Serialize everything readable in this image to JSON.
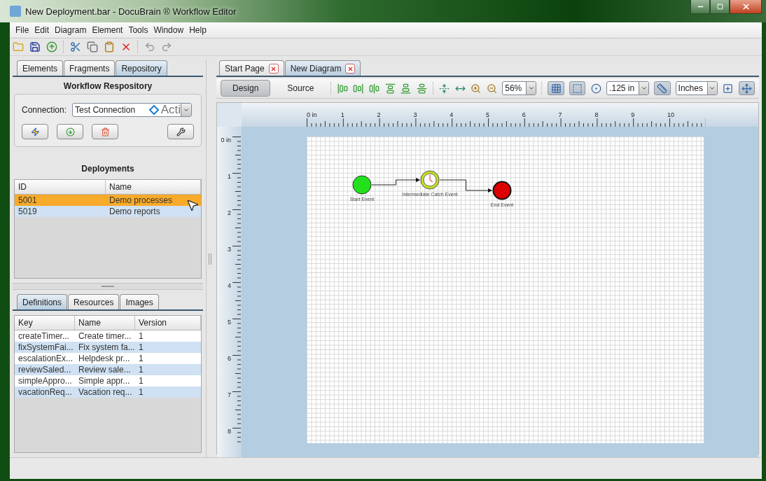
{
  "window": {
    "title": "New Deployment.bar - DocuBrain ® Workflow Editor"
  },
  "menu": [
    "File",
    "Edit",
    "Diagram",
    "Element",
    "Tools",
    "Window",
    "Help"
  ],
  "toolbar": [
    {
      "kind": "open",
      "disabled": false
    },
    {
      "kind": "save",
      "disabled": false
    },
    {
      "kind": "deploy",
      "disabled": false
    },
    {
      "kind": "separator"
    },
    {
      "kind": "cut",
      "disabled": false
    },
    {
      "kind": "copy",
      "disabled": false
    },
    {
      "kind": "paste",
      "disabled": false
    },
    {
      "kind": "delete",
      "disabled": false
    },
    {
      "kind": "separator"
    },
    {
      "kind": "undo",
      "disabled": true
    },
    {
      "kind": "redo",
      "disabled": true
    }
  ],
  "side_tabs": [
    {
      "label": "Elements",
      "selected": false
    },
    {
      "label": "Fragments",
      "selected": false
    },
    {
      "label": "Repository",
      "selected": true
    }
  ],
  "repository": {
    "title": "Workflow Respository",
    "connection_label": "Connection:",
    "connection_value": "Test Connection",
    "connection_brand": "Acti"
  },
  "deployments": {
    "title": "Deployments",
    "columns": [
      "ID",
      "Name"
    ],
    "rows": [
      {
        "cells": [
          "5001",
          "Demo processes"
        ],
        "selected": true
      },
      {
        "cells": [
          "5019",
          "Demo reports"
        ],
        "selected": false
      }
    ]
  },
  "lower_tabs": [
    {
      "label": "Definitions",
      "selected": true
    },
    {
      "label": "Resources",
      "selected": false
    },
    {
      "label": "Images",
      "selected": false
    }
  ],
  "definitions": {
    "columns": [
      "Key",
      "Name",
      "Version"
    ],
    "rows": [
      [
        "createTimer...",
        "Create timer...",
        "1"
      ],
      [
        "fixSystemFai...",
        "Fix system fa...",
        "1"
      ],
      [
        "escalationEx...",
        "Helpdesk pr...",
        "1"
      ],
      [
        "reviewSaled...",
        "Review sale...",
        "1"
      ],
      [
        "simpleAppro...",
        "Simple appr...",
        "1"
      ],
      [
        "vacationReq...",
        "Vacation req...",
        "1"
      ]
    ]
  },
  "doc_tabs": [
    {
      "label": "Start Page",
      "selected": false
    },
    {
      "label": "New Diagram",
      "selected": true
    }
  ],
  "modes": [
    {
      "label": "Design",
      "selected": true
    },
    {
      "label": "Source",
      "selected": false
    }
  ],
  "diagram_toolbar": [
    {
      "kind": "align-left",
      "pressed": false
    },
    {
      "kind": "align-right",
      "pressed": false
    },
    {
      "kind": "align-center",
      "pressed": false
    },
    {
      "kind": "align-top",
      "pressed": false
    },
    {
      "kind": "align-bottom",
      "pressed": false
    },
    {
      "kind": "align-middle",
      "pressed": false
    },
    {
      "kind": "separator"
    },
    {
      "kind": "fit-height",
      "pressed": false
    },
    {
      "kind": "fit-width",
      "pressed": false
    },
    {
      "kind": "zoom-in",
      "pressed": false
    },
    {
      "kind": "zoom-out",
      "pressed": false
    },
    {
      "kind": "combo",
      "value": "56%"
    },
    {
      "kind": "separator"
    },
    {
      "kind": "grid",
      "pressed": true
    },
    {
      "kind": "snap",
      "pressed": true
    },
    {
      "kind": "marker",
      "pressed": false
    },
    {
      "kind": "combo",
      "value": ".125 in"
    },
    {
      "kind": "ruler",
      "pressed": true
    },
    {
      "kind": "combo",
      "value": "Inches"
    },
    {
      "kind": "add-node",
      "pressed": false
    },
    {
      "kind": "move-node",
      "pressed": true
    }
  ],
  "ruler": {
    "horizontal": [
      "0 in",
      "1",
      "2",
      "3",
      "4",
      "5",
      "6",
      "7",
      "8",
      "9",
      "10"
    ],
    "vertical": [
      "0 in",
      "1",
      "2",
      "3",
      "4",
      "5",
      "6",
      "7",
      "8"
    ]
  },
  "diagram": {
    "nodes": [
      {
        "kind": "start",
        "label": "Start Event"
      },
      {
        "kind": "timer",
        "label": "Intermediate Catch Event"
      },
      {
        "kind": "end",
        "label": "End Event"
      }
    ]
  }
}
